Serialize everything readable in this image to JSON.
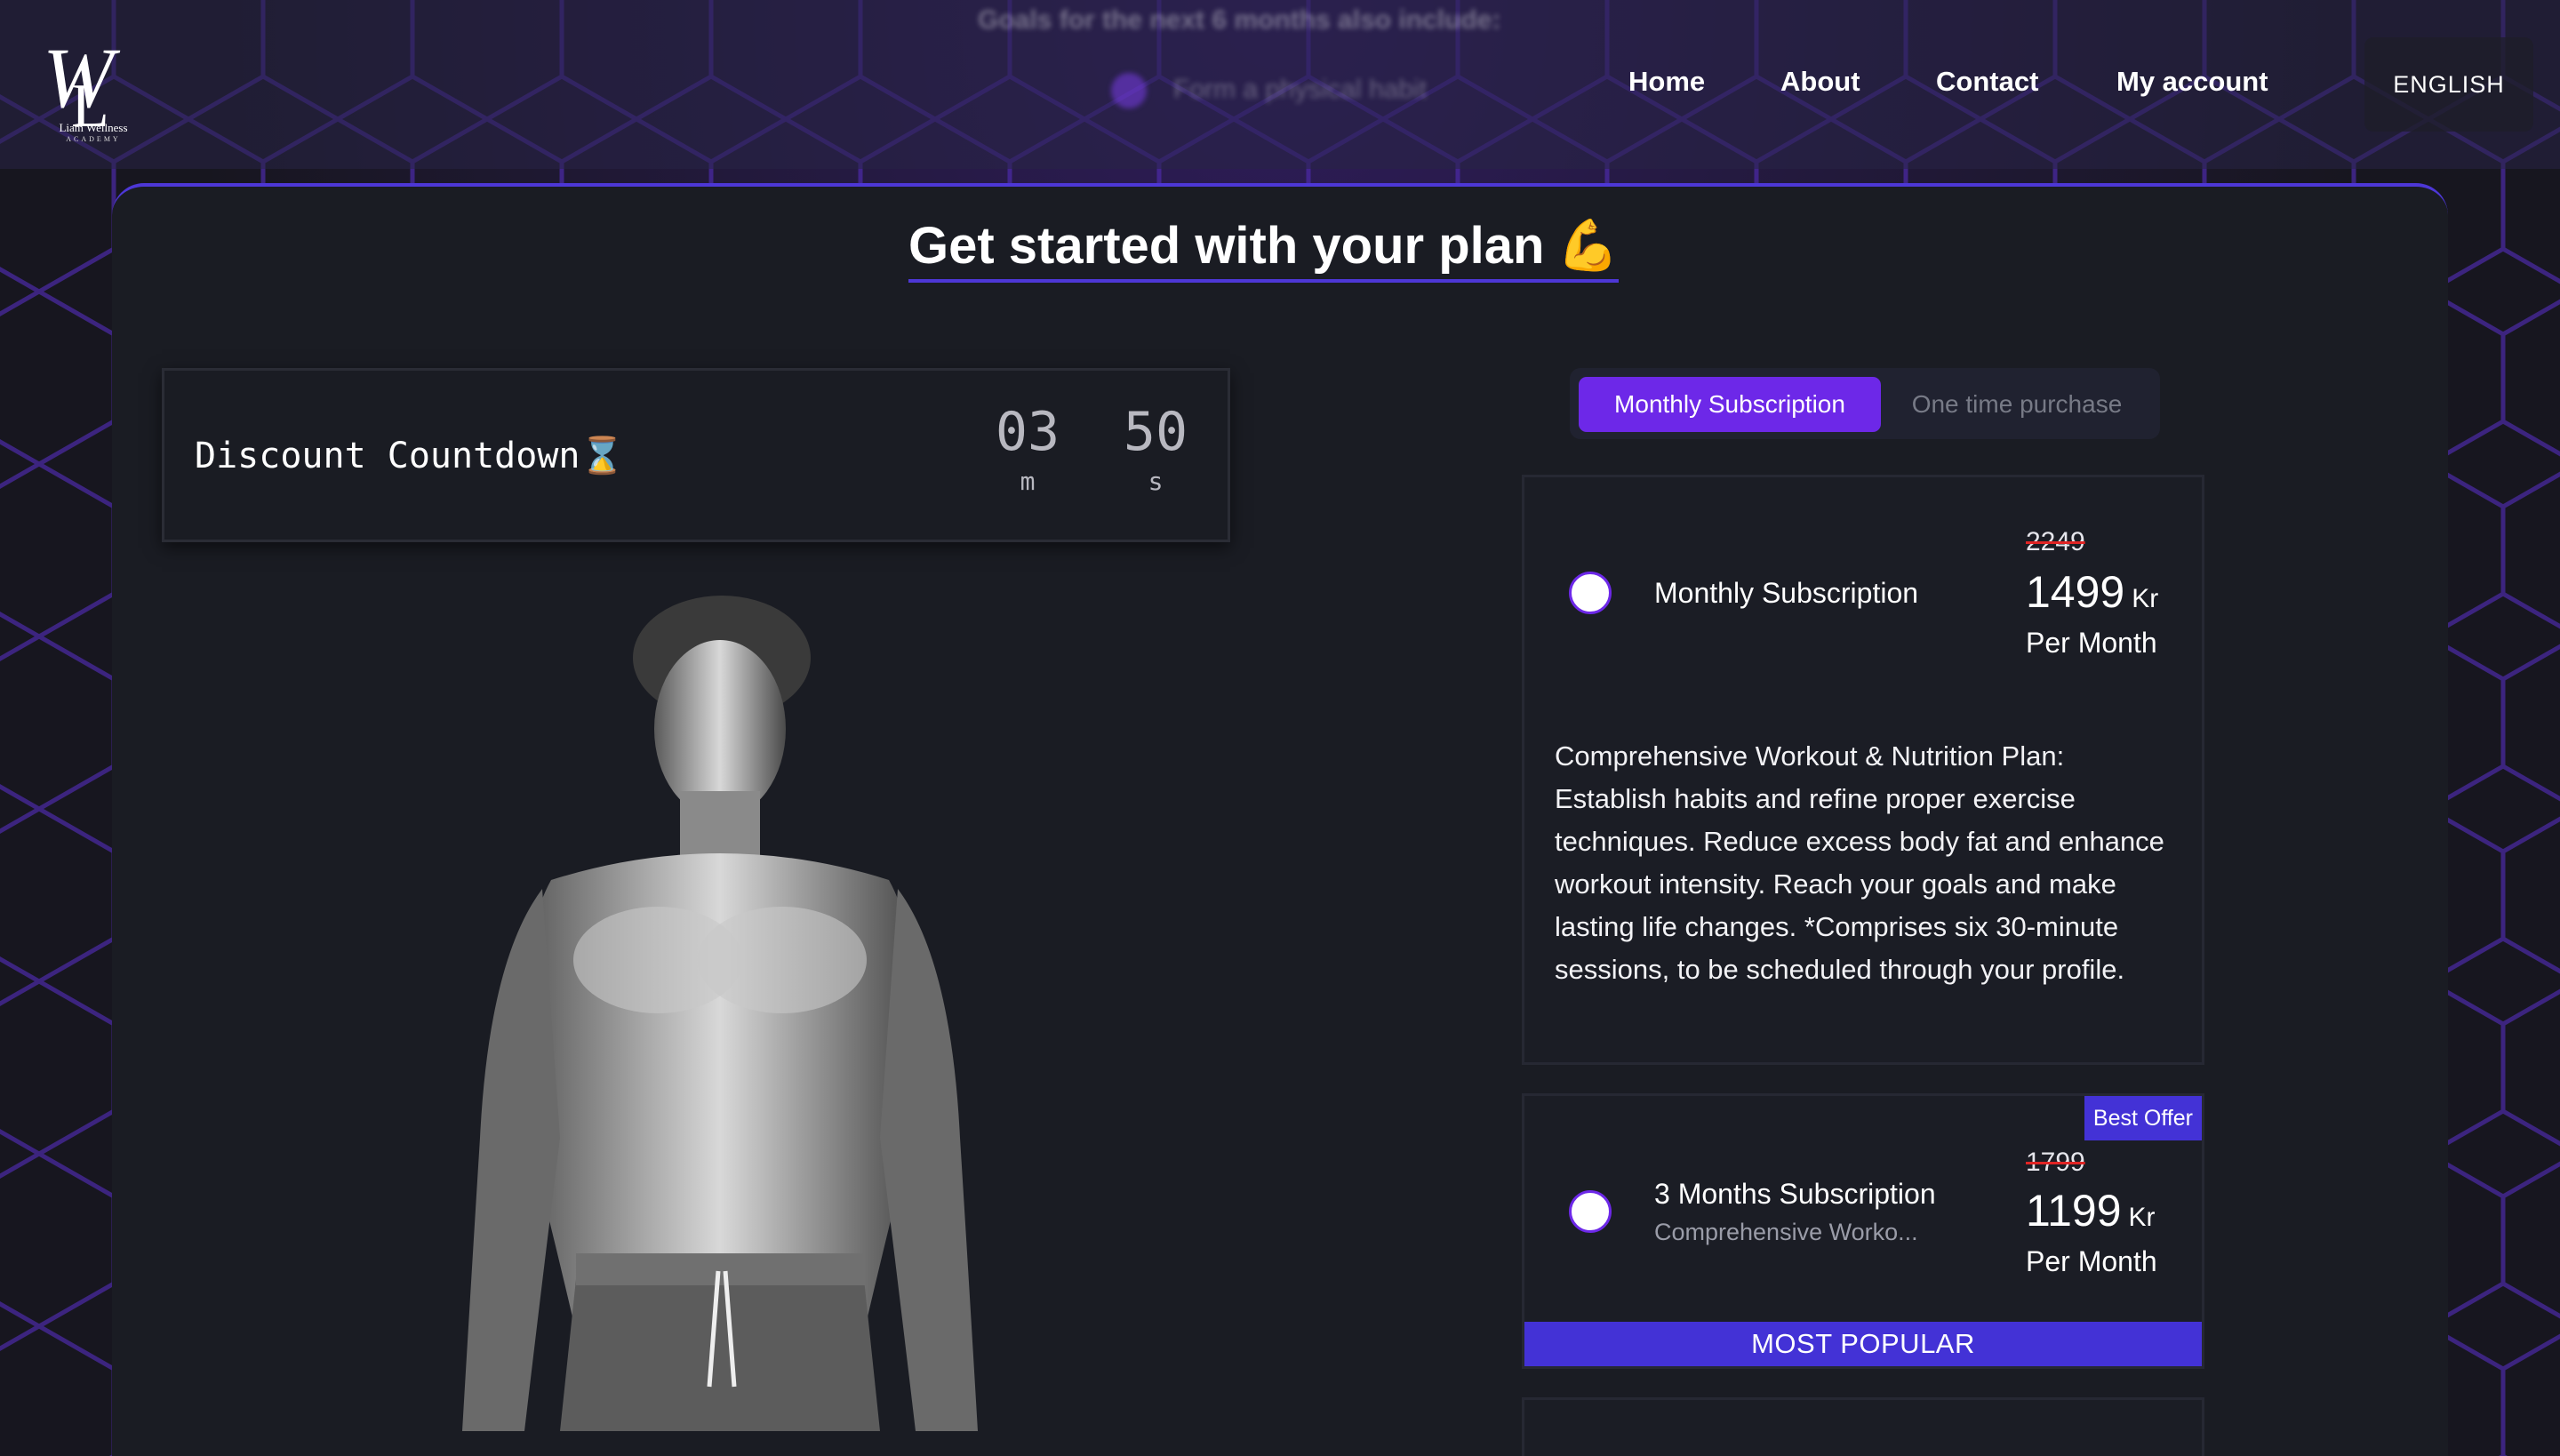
{
  "header": {
    "logo_text": "Liam Wellness",
    "logo_subtext": "ACADEMY",
    "blurred_heading": "Goals for the next 6 months also include:",
    "blurred_item": "Form a physical habit",
    "nav": {
      "home": "Home",
      "about": "About",
      "contact": "Contact",
      "my_account": "My account"
    },
    "language": "ENGLISH"
  },
  "main": {
    "title": "Get started with your plan",
    "title_emoji": "💪",
    "countdown": {
      "label": "Discount Countdown⌛",
      "minutes": "03",
      "minutes_unit": "m",
      "seconds": "50",
      "seconds_unit": "s"
    },
    "tabs": {
      "active": "Monthly Subscription",
      "inactive": "One time purchase"
    },
    "plans": [
      {
        "name": "Monthly Subscription",
        "old_price": "2249",
        "price": "1499",
        "currency": "Kr",
        "period": "Per Month",
        "description": "Comprehensive Workout & Nutrition Plan: Establish habits and refine proper exercise techniques. Reduce excess body fat and enhance workout intensity. Reach your goals and make lasting life changes. *Comprises six 30-minute sessions, to be scheduled through your profile."
      },
      {
        "name": "3 Months Subscription",
        "subtitle": "Comprehensive Worko...",
        "old_price": "1799",
        "price": "1199",
        "currency": "Kr",
        "period": "Per Month",
        "badge": "Best Offer",
        "banner": "MOST POPULAR"
      }
    ]
  },
  "colors": {
    "accent": "#6d28e8",
    "brand_indigo": "#4332d6",
    "background": "#1a1c23"
  }
}
